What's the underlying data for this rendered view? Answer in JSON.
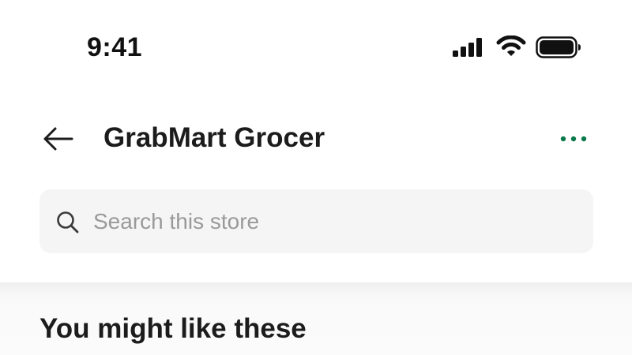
{
  "status_bar": {
    "time": "9:41",
    "icons": [
      "signal-icon",
      "wifi-icon",
      "battery-icon"
    ]
  },
  "header": {
    "title": "GrabMart Grocer",
    "back_icon": "arrow-left-icon",
    "more_icon": "more-dots-icon",
    "accent_color": "#0a7a4b"
  },
  "search": {
    "placeholder": "Search this store",
    "value": "",
    "icon": "search-icon"
  },
  "main": {
    "section_title": "You might like these"
  }
}
